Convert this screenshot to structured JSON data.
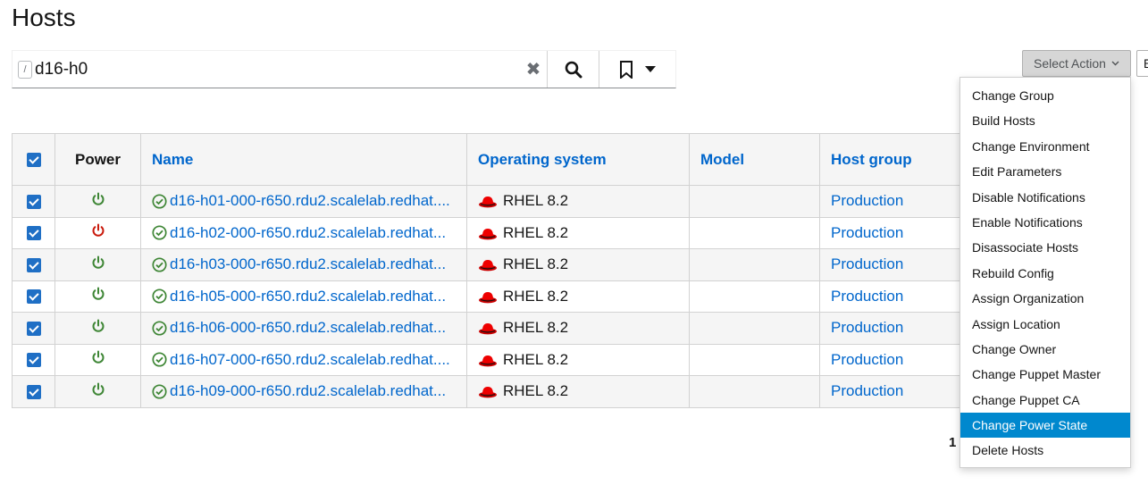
{
  "page": {
    "title": "Hosts"
  },
  "search": {
    "hint": "/",
    "value": "d16-h0"
  },
  "toolbar": {
    "select_action_label": "Select Action",
    "edge_button_label": "E"
  },
  "table": {
    "columns": [
      "Power",
      "Name",
      "Operating system",
      "Model",
      "Host group"
    ],
    "rows": [
      {
        "power": "on",
        "name": "d16-h01-000-r650.rdu2.scalelab.redhat....",
        "os": "RHEL 8.2",
        "model": "",
        "host_group": "Production"
      },
      {
        "power": "off",
        "name": "d16-h02-000-r650.rdu2.scalelab.redhat...",
        "os": "RHEL 8.2",
        "model": "",
        "host_group": "Production"
      },
      {
        "power": "on",
        "name": "d16-h03-000-r650.rdu2.scalelab.redhat...",
        "os": "RHEL 8.2",
        "model": "",
        "host_group": "Production"
      },
      {
        "power": "on",
        "name": "d16-h05-000-r650.rdu2.scalelab.redhat...",
        "os": "RHEL 8.2",
        "model": "",
        "host_group": "Production"
      },
      {
        "power": "on",
        "name": "d16-h06-000-r650.rdu2.scalelab.redhat...",
        "os": "RHEL 8.2",
        "model": "",
        "host_group": "Production"
      },
      {
        "power": "on",
        "name": "d16-h07-000-r650.rdu2.scalelab.redhat....",
        "os": "RHEL 8.2",
        "model": "",
        "host_group": "Production"
      },
      {
        "power": "on",
        "name": "d16-h09-000-r650.rdu2.scalelab.redhat...",
        "os": "RHEL 8.2",
        "model": "",
        "host_group": "Production"
      }
    ]
  },
  "menu": {
    "items": [
      "Change Group",
      "Build Hosts",
      "Change Environment",
      "Edit Parameters",
      "Disable Notifications",
      "Enable Notifications",
      "Disassociate Hosts",
      "Rebuild Config",
      "Assign Organization",
      "Assign Location",
      "Change Owner",
      "Change Puppet Master",
      "Change Puppet CA",
      "Change Power State",
      "Delete Hosts"
    ],
    "active": "Change Power State"
  },
  "pagination": {
    "fragment": "1"
  },
  "colors": {
    "link": "#0066cc",
    "power_on": "#3e8635",
    "power_off": "#c9190b",
    "menu_active": "#0088ce",
    "checkbox": "#1f6fc5"
  },
  "icons": {
    "power": "power-icon",
    "status": "check-circle-icon",
    "os": "redhat-logo-icon"
  }
}
